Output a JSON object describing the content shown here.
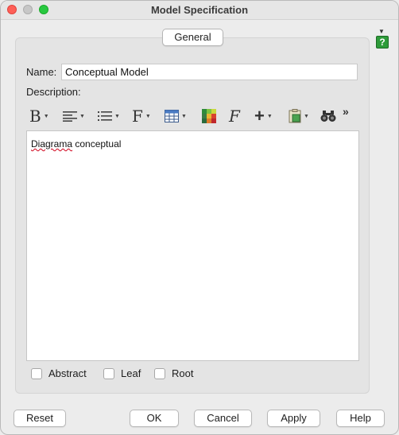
{
  "window": {
    "title": "Model Specification"
  },
  "tabs": [
    {
      "label": "General"
    }
  ],
  "help_icon": "?",
  "form": {
    "name_label": "Name:",
    "name_value": "Conceptual Model",
    "description_label": "Description:",
    "description_text_misspelled": "Diagrama",
    "description_text_rest": " conceptual"
  },
  "toolbar": {
    "bold_glyph": "B",
    "font_glyph": "F",
    "font_effects_glyph": "F",
    "insert_glyph": "+",
    "more_glyph": "»",
    "items": [
      "bold-icon",
      "align-icon",
      "list-icon",
      "font-icon",
      "table-icon",
      "color-icon",
      "font-effects-icon",
      "insert-icon",
      "paste-icon",
      "find-icon",
      "more-icon"
    ]
  },
  "checkboxes": [
    {
      "label": "Abstract",
      "checked": false
    },
    {
      "label": "Leaf",
      "checked": false
    },
    {
      "label": "Root",
      "checked": false
    }
  ],
  "buttons": {
    "reset": "Reset",
    "ok": "OK",
    "cancel": "Cancel",
    "apply": "Apply",
    "help": "Help"
  },
  "colors": {
    "close": "#fe5f57",
    "minimize": "#c7c7c7",
    "maximize": "#28c840",
    "help_green": "#2e9b3a",
    "spell_error": "#d0021b"
  }
}
